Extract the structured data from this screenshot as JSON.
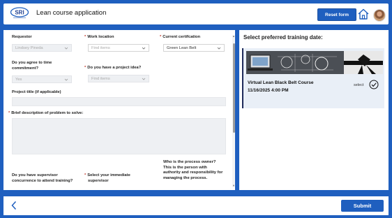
{
  "header": {
    "logo_text": "SRI",
    "title": "Lean course application",
    "reset_label": "Reset form"
  },
  "form": {
    "requestor": {
      "label": "Requestor",
      "value": "Lindsey Pineda"
    },
    "work_location": {
      "label": "Work location",
      "placeholder": "Find items"
    },
    "current_cert": {
      "label": "Current certifcation",
      "value": "Green Lean Belt"
    },
    "time_commitment": {
      "label_line1": "Do you agree to time",
      "label_line2": "commitment?",
      "value": "Yes"
    },
    "project_idea": {
      "label": "Do you have a project idea?",
      "placeholder": "Find items"
    },
    "project_title": {
      "label": "Project title (if applicable)"
    },
    "problem_desc": {
      "label": "Brief description of problem to solve:"
    },
    "supervisor_concurrence": {
      "label_line1": "Do you have supervisor",
      "label_line2": "concurrence to attend training?"
    },
    "immediate_supervisor": {
      "label_line1": "Select your immediate",
      "label_line2": "supervisor"
    },
    "process_owner": {
      "label_line1": "Who is the process owner?",
      "label_line2": "This is the person with",
      "label_line3": "authority and responsibility for",
      "label_line4": "managing the process."
    }
  },
  "training": {
    "title": "Select preferred training date:",
    "courses": [
      {
        "name": "Virtual Lean Black Belt Course",
        "date": "11/16/2025 4:00 PM",
        "select_label": "select"
      }
    ]
  },
  "footer": {
    "submit_label": "Submit"
  },
  "colors": {
    "brand_blue": "#1f5fbf",
    "required_red": "#c0392b",
    "card_bg": "#e9eff7",
    "card_accent": "#1e2a5a"
  },
  "icons": [
    "sri-logo",
    "home-icon",
    "avatar",
    "chevron-down-icon",
    "check-circle-icon",
    "back-chevron-icon"
  ]
}
